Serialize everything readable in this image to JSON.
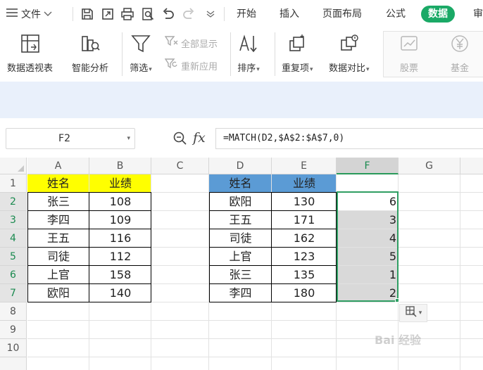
{
  "menubar": {
    "file_label": "文件",
    "tabs": [
      {
        "label": "开始",
        "active": false
      },
      {
        "label": "插入",
        "active": false
      },
      {
        "label": "页面布局",
        "active": false
      },
      {
        "label": "公式",
        "active": false
      },
      {
        "label": "数据",
        "active": true
      },
      {
        "label": "审",
        "active": false
      }
    ],
    "quick_access_icons": [
      "save-icon",
      "export-icon",
      "print-icon",
      "print-preview-icon",
      "undo-icon",
      "redo-icon",
      "customize-icon"
    ]
  },
  "ribbon": {
    "pivot_table": "数据透视表",
    "smart_analysis": "智能分析",
    "filter": "筛选",
    "show_all": "全部显示",
    "reapply": "重新应用",
    "sort": "排序",
    "duplicates": "重复项",
    "compare": "数据对比",
    "stocks": "股票",
    "funds": "基金"
  },
  "formula_bar": {
    "cell_ref": "F2",
    "formula": "=MATCH(D2,$A$2:$A$7,0)",
    "fx_label": "fx"
  },
  "sheet": {
    "columns": [
      "A",
      "B",
      "C",
      "D",
      "E",
      "F",
      "G"
    ],
    "rows": [
      "1",
      "2",
      "3",
      "4",
      "5",
      "6",
      "7",
      "8",
      "9",
      "10"
    ],
    "selected_column": "F",
    "table1": {
      "headers": [
        "姓名",
        "业绩"
      ],
      "rows": [
        [
          "张三",
          "108"
        ],
        [
          "李四",
          "109"
        ],
        [
          "王五",
          "116"
        ],
        [
          "司徒",
          "112"
        ],
        [
          "上官",
          "158"
        ],
        [
          "欧阳",
          "140"
        ]
      ],
      "header_color": "#ffff00"
    },
    "table2": {
      "headers": [
        "姓名",
        "业绩"
      ],
      "rows": [
        [
          "欧阳",
          "130"
        ],
        [
          "王五",
          "171"
        ],
        [
          "司徒",
          "162"
        ],
        [
          "上官",
          "123"
        ],
        [
          "张三",
          "135"
        ],
        [
          "李四",
          "180"
        ]
      ],
      "header_color": "#5b9bd5"
    },
    "results": [
      "6",
      "3",
      "4",
      "5",
      "1",
      "2"
    ]
  },
  "colors": {
    "active_tab": "#1aa966",
    "selection": "#2f9e63",
    "band": "#e9f0fb"
  },
  "watermark": "Bai 经验"
}
